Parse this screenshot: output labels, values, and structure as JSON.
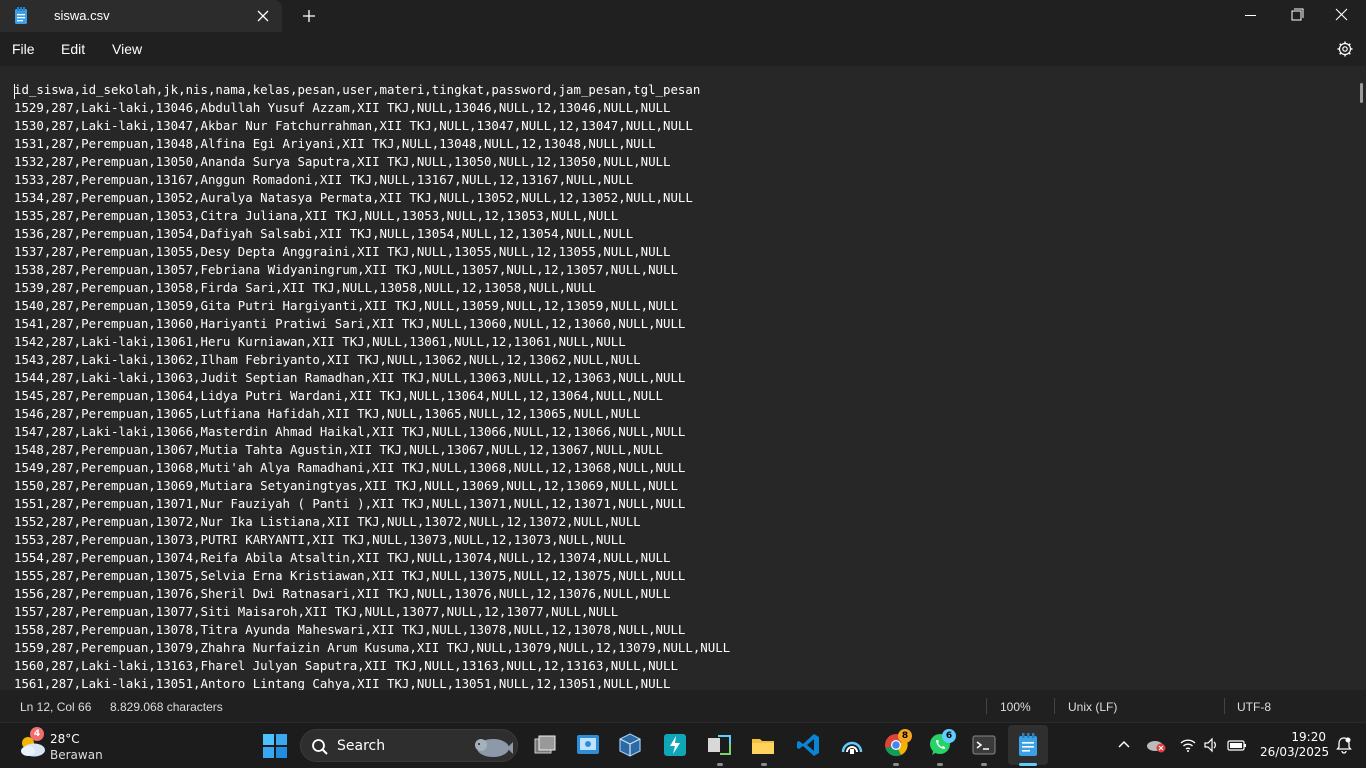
{
  "window": {
    "tab_title": "siswa.csv",
    "icons": {
      "app": "notepad-icon",
      "close_tab": "close-icon",
      "new_tab": "plus-icon",
      "minimize": "minimize-icon",
      "maximize": "maximize-icon",
      "close": "close-icon"
    }
  },
  "menu": {
    "file": "File",
    "edit": "Edit",
    "view": "View",
    "settings_icon": "gear-icon"
  },
  "editor": {
    "lines": [
      "id_siswa,id_sekolah,jk,nis,nama,kelas,pesan,user,materi,tingkat,password,jam_pesan,tgl_pesan",
      "1529,287,Laki-laki,13046,Abdullah Yusuf Azzam,XII TKJ,NULL,13046,NULL,12,13046,NULL,NULL",
      "1530,287,Laki-laki,13047,Akbar Nur Fatchurrahman,XII TKJ,NULL,13047,NULL,12,13047,NULL,NULL",
      "1531,287,Perempuan,13048,Alfina Egi Ariyani,XII TKJ,NULL,13048,NULL,12,13048,NULL,NULL",
      "1532,287,Perempuan,13050,Ananda Surya Saputra,XII TKJ,NULL,13050,NULL,12,13050,NULL,NULL",
      "1533,287,Perempuan,13167,Anggun Romadoni,XII TKJ,NULL,13167,NULL,12,13167,NULL,NULL",
      "1534,287,Perempuan,13052,Auralya Natasya Permata,XII TKJ,NULL,13052,NULL,12,13052,NULL,NULL",
      "1535,287,Perempuan,13053,Citra Juliana,XII TKJ,NULL,13053,NULL,12,13053,NULL,NULL",
      "1536,287,Perempuan,13054,Dafiyah Salsabi,XII TKJ,NULL,13054,NULL,12,13054,NULL,NULL",
      "1537,287,Perempuan,13055,Desy Depta Anggraini,XII TKJ,NULL,13055,NULL,12,13055,NULL,NULL",
      "1538,287,Perempuan,13057,Febriana Widyaningrum,XII TKJ,NULL,13057,NULL,12,13057,NULL,NULL",
      "1539,287,Perempuan,13058,Firda Sari,XII TKJ,NULL,13058,NULL,12,13058,NULL,NULL",
      "1540,287,Perempuan,13059,Gita Putri Hargiyanti,XII TKJ,NULL,13059,NULL,12,13059,NULL,NULL",
      "1541,287,Perempuan,13060,Hariyanti Pratiwi Sari,XII TKJ,NULL,13060,NULL,12,13060,NULL,NULL",
      "1542,287,Laki-laki,13061,Heru Kurniawan,XII TKJ,NULL,13061,NULL,12,13061,NULL,NULL",
      "1543,287,Laki-laki,13062,Ilham Febriyanto,XII TKJ,NULL,13062,NULL,12,13062,NULL,NULL",
      "1544,287,Laki-laki,13063,Judit Septian Ramadhan,XII TKJ,NULL,13063,NULL,12,13063,NULL,NULL",
      "1545,287,Perempuan,13064,Lidya Putri Wardani,XII TKJ,NULL,13064,NULL,12,13064,NULL,NULL",
      "1546,287,Perempuan,13065,Lutfiana Hafidah,XII TKJ,NULL,13065,NULL,12,13065,NULL,NULL",
      "1547,287,Laki-laki,13066,Masterdin Ahmad Haikal,XII TKJ,NULL,13066,NULL,12,13066,NULL,NULL",
      "1548,287,Perempuan,13067,Mutia Tahta Agustin,XII TKJ,NULL,13067,NULL,12,13067,NULL,NULL",
      "1549,287,Perempuan,13068,Muti'ah Alya Ramadhani,XII TKJ,NULL,13068,NULL,12,13068,NULL,NULL",
      "1550,287,Perempuan,13069,Mutiara Setyaningtyas,XII TKJ,NULL,13069,NULL,12,13069,NULL,NULL",
      "1551,287,Perempuan,13071,Nur Fauziyah ( Panti ),XII TKJ,NULL,13071,NULL,12,13071,NULL,NULL",
      "1552,287,Perempuan,13072,Nur Ika Listiana,XII TKJ,NULL,13072,NULL,12,13072,NULL,NULL",
      "1553,287,Perempuan,13073,PUTRI KARYANTI,XII TKJ,NULL,13073,NULL,12,13073,NULL,NULL",
      "1554,287,Perempuan,13074,Reifa Abila Atsaltin,XII TKJ,NULL,13074,NULL,12,13074,NULL,NULL",
      "1555,287,Perempuan,13075,Selvia Erna Kristiawan,XII TKJ,NULL,13075,NULL,12,13075,NULL,NULL",
      "1556,287,Perempuan,13076,Sheril Dwi Ratnasari,XII TKJ,NULL,13076,NULL,12,13076,NULL,NULL",
      "1557,287,Perempuan,13077,Siti Maisaroh,XII TKJ,NULL,13077,NULL,12,13077,NULL,NULL",
      "1558,287,Perempuan,13078,Titra Ayunda Maheswari,XII TKJ,NULL,13078,NULL,12,13078,NULL,NULL",
      "1559,287,Perempuan,13079,Zhahra Nurfaizin Arum Kusuma,XII TKJ,NULL,13079,NULL,12,13079,NULL,NULL",
      "1560,287,Laki-laki,13163,Fharel Julyan Saputra,XII TKJ,NULL,13163,NULL,12,13163,NULL,NULL",
      "1561,287,Laki-laki,13051,Antoro Lintang Cahya,XII TKJ,NULL,13051,NULL,12,13051,NULL,NULL"
    ]
  },
  "status": {
    "position": "Ln 12, Col 66",
    "characters": "8.829.068 characters",
    "zoom": "100%",
    "line_ending": "Unix (LF)",
    "encoding": "UTF-8"
  },
  "taskbar": {
    "weather_badge": "4",
    "weather_temp": "28°C",
    "weather_desc": "Berawan",
    "search_label": "Search",
    "chrome_badge": "8",
    "whatsapp_badge": "6",
    "time": "19:20",
    "date": "26/03/2025",
    "colors": {
      "accent": "#0078d4",
      "orange_badge": "#f5a623",
      "blue_badge": "#60cdff"
    }
  }
}
